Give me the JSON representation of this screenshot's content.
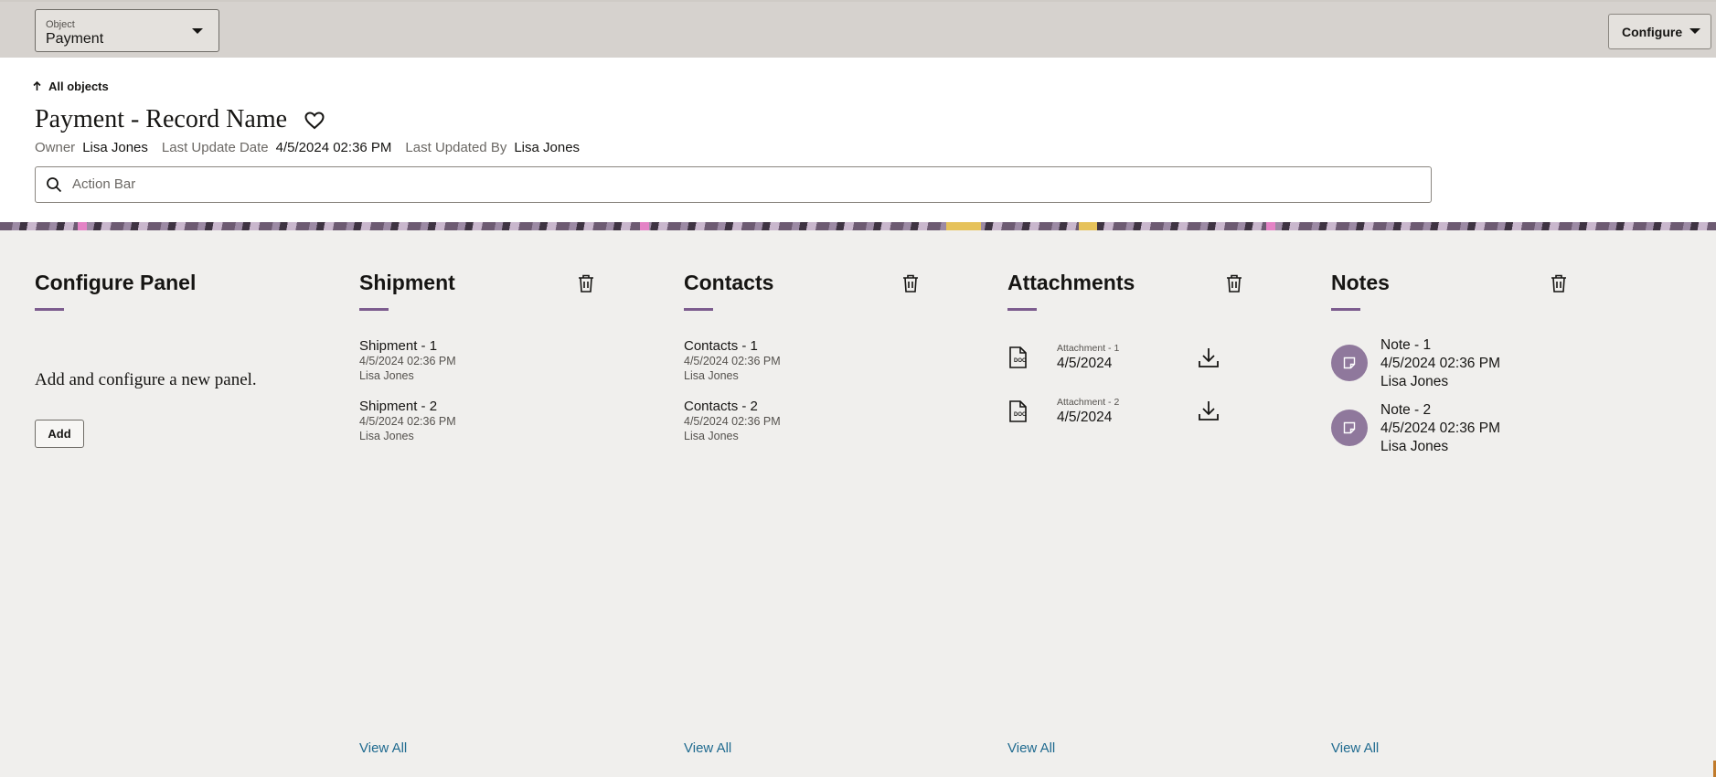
{
  "topbar": {
    "object_select": {
      "label": "Object",
      "value": "Payment"
    },
    "configure_label": "Configure"
  },
  "header": {
    "back_label": "All objects",
    "title": "Payment - Record Name",
    "meta": {
      "owner_label": "Owner",
      "owner_value": "Lisa Jones",
      "last_update_label": "Last Update Date",
      "last_update_value": "4/5/2024 02:36 PM",
      "last_updated_by_label": "Last Updated By",
      "last_updated_by_value": "Lisa Jones"
    },
    "action_bar_placeholder": "Action Bar"
  },
  "panels": {
    "configure": {
      "title": "Configure Panel",
      "text": "Add and configure a new panel.",
      "add_label": "Add"
    },
    "shipment": {
      "title": "Shipment",
      "items": [
        {
          "name": "Shipment - 1",
          "date": "4/5/2024 02:36 PM",
          "user": "Lisa Jones"
        },
        {
          "name": "Shipment - 2",
          "date": "4/5/2024 02:36 PM",
          "user": "Lisa Jones"
        }
      ],
      "view_all": "View All"
    },
    "contacts": {
      "title": "Contacts",
      "items": [
        {
          "name": "Contacts - 1",
          "date": "4/5/2024 02:36 PM",
          "user": "Lisa Jones"
        },
        {
          "name": "Contacts - 2",
          "date": "4/5/2024 02:36 PM",
          "user": "Lisa Jones"
        }
      ],
      "view_all": "View All"
    },
    "attachments": {
      "title": "Attachments",
      "items": [
        {
          "name": "Attachment - 1",
          "date": "4/5/2024"
        },
        {
          "name": "Attachment - 2",
          "date": "4/5/2024"
        }
      ],
      "view_all": "View All"
    },
    "notes": {
      "title": "Notes",
      "items": [
        {
          "name": "Note - 1",
          "date": "4/5/2024 02:36 PM",
          "user": "Lisa Jones"
        },
        {
          "name": "Note - 2",
          "date": "4/5/2024 02:36 PM",
          "user": "Lisa Jones"
        }
      ],
      "view_all": "View All"
    }
  },
  "icons": [
    "chevron-down-icon",
    "arrow-up-icon",
    "heart-icon",
    "search-icon",
    "trash-icon",
    "doc-file-icon",
    "download-icon",
    "note-icon"
  ],
  "colors": {
    "accent": "#7c5c8e",
    "link": "#1f6a8f",
    "avatar": "#8f789c",
    "topbar": "#d6d2ce",
    "background": "#f0efed"
  }
}
